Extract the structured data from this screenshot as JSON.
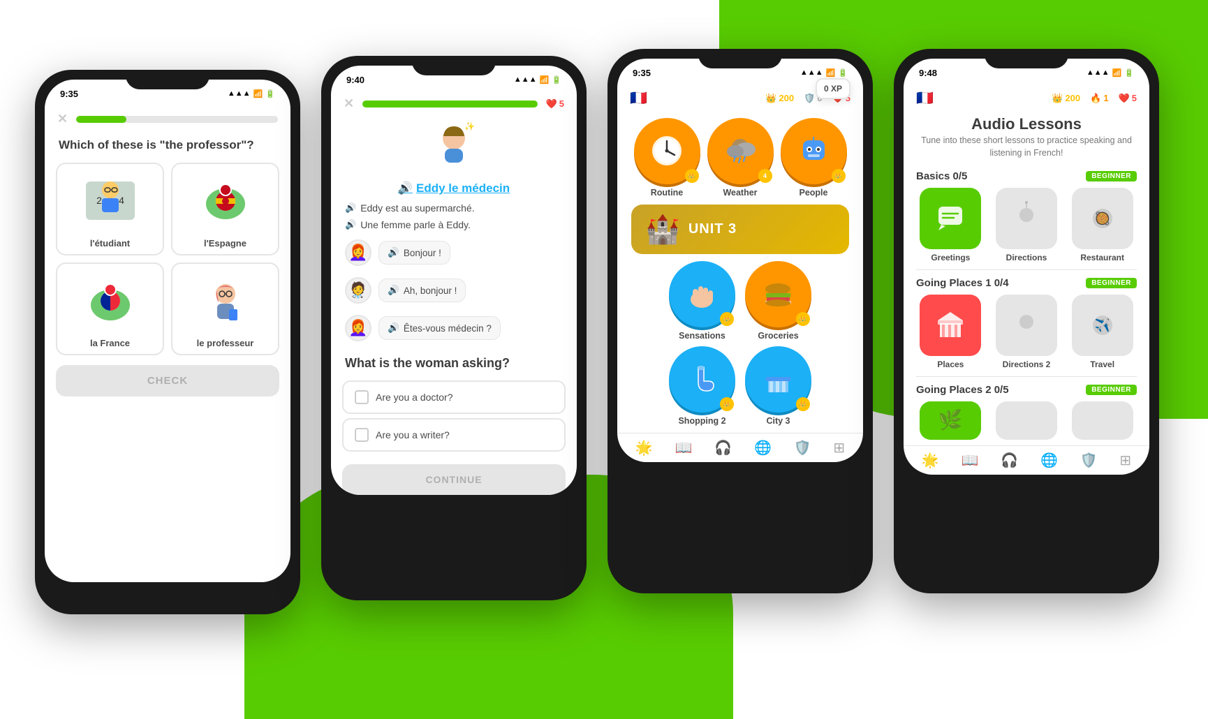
{
  "background": {
    "accent_color": "#58cc02",
    "white": "#ffffff"
  },
  "phone1": {
    "status_time": "9:35",
    "question": "Which of these is \"the professor\"?",
    "options": [
      {
        "label": "l'étudiant",
        "emoji": "🧑‍🏫",
        "bg": "#e8f4e8"
      },
      {
        "label": "l'Espagne",
        "emoji": "📍",
        "bg": "#fde8e8"
      },
      {
        "label": "la France",
        "emoji": "📍",
        "bg": "#e8eef8"
      },
      {
        "label": "le professeur",
        "emoji": "👩‍💼",
        "bg": "#fdf0e8"
      }
    ],
    "check_label": "CHECK",
    "progress_pct": 25
  },
  "phone2": {
    "status_time": "9:40",
    "hearts": "5",
    "character_name": "Eddy le médecin",
    "character_emoji": "🧑‍⚕️",
    "dialogue_lines": [
      "Eddy est au supermarché.",
      "Une femme parle à Eddy."
    ],
    "bubbles": [
      {
        "avatar": "👩‍🦰",
        "text": "Bonjour !"
      },
      {
        "avatar": "🧑‍⚕️",
        "text": "Ah, bonjour !"
      },
      {
        "avatar": "👩‍🦰",
        "text": "Êtes-vous médecin ?"
      }
    ],
    "question": "What is the woman asking?",
    "answers": [
      "Are you a doctor?",
      "Are you a writer?"
    ],
    "continue_label": "CONTINUE"
  },
  "phone3": {
    "status_time": "9:35",
    "crown_score": "200",
    "shield_score": "0",
    "heart_score": "5",
    "lessons": [
      {
        "label": "Routine",
        "emoji": "⏰",
        "color": "#ff9600",
        "crown": "1"
      },
      {
        "label": "Weather",
        "emoji": "🌧️",
        "color": "#ff9600",
        "crown": "4"
      },
      {
        "label": "People",
        "emoji": "🤖",
        "color": "#ff9600",
        "crown": "1"
      }
    ],
    "unit": {
      "name": "UNIT 3",
      "emoji": "🏰"
    },
    "lessons2": [
      {
        "label": "Sensations",
        "emoji": "🖐️",
        "color": "#1cb0f6",
        "crown": "1"
      },
      {
        "label": "Groceries",
        "emoji": "🍔",
        "color": "#ff9600",
        "crown": "1"
      }
    ],
    "lessons3": [
      {
        "label": "Shopping 2",
        "emoji": "🧦",
        "color": "#1cb0f6",
        "crown": "1"
      },
      {
        "label": "City 3",
        "emoji": "🏛️",
        "color": "#1cb0f6",
        "crown": "1"
      }
    ],
    "xp_popup": "0 XP"
  },
  "phone4": {
    "status_time": "9:48",
    "crown_score": "200",
    "flame_score": "1",
    "heart_score": "5",
    "title": "Audio Lessons",
    "subtitle": "Tune into these short lessons to practice speaking and listening in French!",
    "sections": [
      {
        "title": "Basics 0/5",
        "badge": "BEGINNER",
        "cards": [
          {
            "label": "Greetings",
            "emoji": "💬",
            "color": "green"
          },
          {
            "label": "Directions",
            "emoji": "📍",
            "color": "gray"
          },
          {
            "label": "Restaurant",
            "emoji": "🥘",
            "color": "gray"
          }
        ]
      },
      {
        "title": "Going Places 1 0/4",
        "badge": "BEGINNER",
        "cards": [
          {
            "label": "Places",
            "emoji": "🏛️",
            "color": "red"
          },
          {
            "label": "Directions 2",
            "emoji": "📍",
            "color": "gray"
          },
          {
            "label": "Travel",
            "emoji": "✈️",
            "color": "gray"
          }
        ]
      },
      {
        "title": "Going Places 2 0/5",
        "badge": "BEGINNER",
        "cards": []
      }
    ]
  }
}
